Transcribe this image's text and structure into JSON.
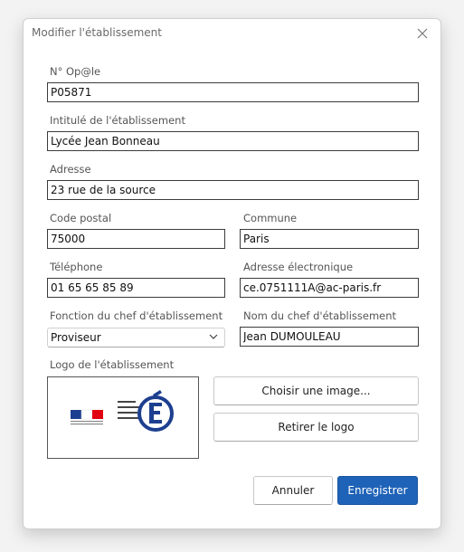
{
  "dialog": {
    "title": "Modifier l'établissement"
  },
  "form": {
    "uai": {
      "label": "N° Op@le",
      "value": "P05871"
    },
    "name": {
      "label": "Intitulé de l'établissement",
      "value": "Lycée Jean Bonneau"
    },
    "address": {
      "label": "Adresse",
      "value": "23 rue de la source"
    },
    "postal_code": {
      "label": "Code postal",
      "value": "75000"
    },
    "city": {
      "label": "Commune",
      "value": "Paris"
    },
    "phone": {
      "label": "Téléphone",
      "value": "01 65 65 85 89"
    },
    "email": {
      "label": "Adresse électronique",
      "value": "ce.0751111A@ac-paris.fr"
    },
    "head_role": {
      "label": "Fonction du chef d'établissement",
      "value": "Proviseur"
    },
    "head_name": {
      "label": "Nom du chef d'établissement",
      "value": "Jean DUMOULEAU"
    },
    "logo": {
      "label": "Logo de l'établissement",
      "choose_label": "Choisir une image...",
      "remove_label": "Retirer le logo"
    }
  },
  "footer": {
    "cancel_label": "Annuler",
    "save_label": "Enregistrer"
  },
  "colors": {
    "primary": "#1f63b8",
    "logo_blue": "#1d3f8f",
    "logo_red": "#e1000f"
  }
}
